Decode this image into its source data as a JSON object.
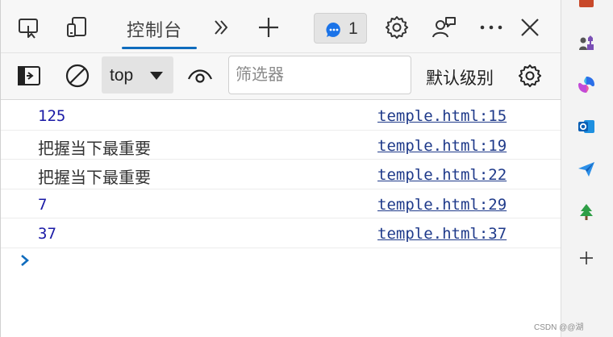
{
  "tabbar": {
    "console_tab_label": "控制台",
    "issues_count": "1"
  },
  "toolbar": {
    "context_value": "top",
    "filter_placeholder": "筛选器",
    "levels_label": "默认级别"
  },
  "messages": [
    {
      "text": "125",
      "kind": "num",
      "source": "temple.html:15"
    },
    {
      "text": "把握当下最重要",
      "kind": "txt",
      "source": "temple.html:19"
    },
    {
      "text": "把握当下最重要",
      "kind": "txt",
      "source": "temple.html:22"
    },
    {
      "text": "7",
      "kind": "num",
      "source": "temple.html:29"
    },
    {
      "text": "37",
      "kind": "num",
      "source": "temple.html:37"
    }
  ],
  "sidebar": {
    "icons": [
      "toolbox-icon",
      "chess-icon",
      "copilot-icon",
      "outlook-icon",
      "send-icon",
      "tree-icon",
      "add-icon"
    ]
  },
  "watermark": "CSDN @@湖",
  "colors": {
    "accent": "#0f6cbd",
    "number_text": "#1a1aa6",
    "link": "#1f3a8a"
  }
}
